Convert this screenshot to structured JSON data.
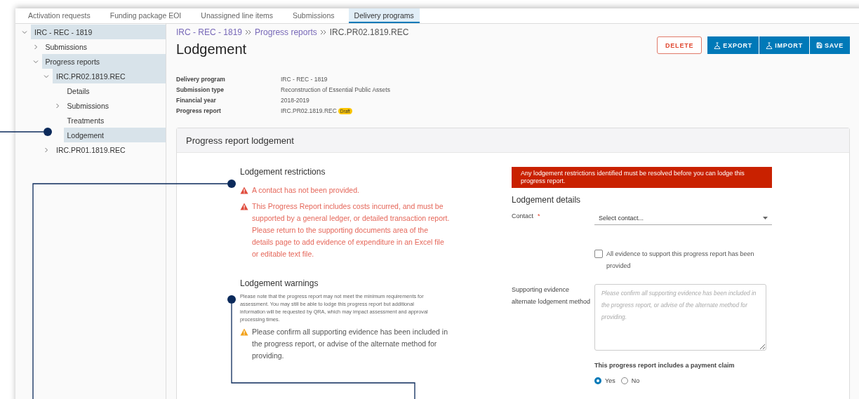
{
  "tabs": [
    {
      "label": "Activation requests",
      "selected": false
    },
    {
      "label": "Funding package EOI",
      "selected": false
    },
    {
      "label": "Unassigned line items",
      "selected": false
    },
    {
      "label": "Submissions",
      "selected": false
    },
    {
      "label": "Delivery programs",
      "selected": true
    }
  ],
  "sidebar": {
    "items": [
      {
        "label": "IRC - REC - 1819",
        "selected": true,
        "expanded": true,
        "children": [
          {
            "label": "Submissions",
            "selected": false,
            "expanded": false
          },
          {
            "label": "Progress reports",
            "selected": true,
            "expanded": true,
            "children": [
              {
                "label": "IRC.PR02.1819.REC",
                "selected": true,
                "expanded": true,
                "children": [
                  {
                    "label": "Details",
                    "selected": false
                  },
                  {
                    "label": "Submissions",
                    "selected": false,
                    "expanded": false
                  },
                  {
                    "label": "Treatments",
                    "selected": false
                  },
                  {
                    "label": "Lodgement",
                    "selected": true
                  }
                ]
              },
              {
                "label": "IRC.PR01.1819.REC",
                "selected": false,
                "expanded": false
              }
            ]
          }
        ]
      }
    ]
  },
  "breadcrumb": [
    {
      "label": "IRC - REC - 1819",
      "kind": "link"
    },
    {
      "label": "Progress reports",
      "kind": "link"
    },
    {
      "label": "IRC.PR02.1819.REC",
      "kind": "current"
    }
  ],
  "title": "Lodgement",
  "actions": [
    {
      "label": "DELETE",
      "kind": "danger"
    },
    {
      "label": "EXPORT",
      "kind": "export"
    },
    {
      "label": "IMPORT",
      "kind": "import"
    },
    {
      "label": "SAVE",
      "kind": "save"
    }
  ],
  "details": [
    {
      "label": "Delivery program",
      "value": "IRC - REC - 1819"
    },
    {
      "label": "Submission type",
      "value": "Reconstruction of Essential Public Assets"
    },
    {
      "label": "Financial year",
      "value": "2018-2019"
    },
    {
      "label": "Progress report",
      "value": "IRC.PR02.1819.REC",
      "badge": "Draft"
    }
  ],
  "card": {
    "title": "Progress report lodgement",
    "restrictions": {
      "heading": "Lodgement restrictions",
      "items": [
        "A contact has not been provided.",
        "This Progress Report includes costs incurred, and must be supported by a general ledger, or detailed transaction report. Please return to the supporting documents area of the details page to add evidence of expenditure in an Excel file or editable text file."
      ]
    },
    "warnings": {
      "heading": "Lodgement warnings",
      "note": "Please note that the progress report may not meet the minimum requirements for assessment. You may still be able to lodge this progress report but additional information will be requested by QRA, which may impact assessment and approval processing times.",
      "items": [
        "Please confirm all supporting evidence has been included in the progress report, or advise of the alternate method for providing."
      ]
    },
    "alert": "Any lodgement restrictions identified must be resolved before you can lodge this progress report.",
    "form": {
      "heading": "Lodgement details",
      "contact": {
        "label": "Contact",
        "required_mark": "*",
        "placeholder": "Select contact..."
      },
      "evidence_checkbox": {
        "label": "All evidence to support this progress report has been provided",
        "checked": false
      },
      "alternate_method": {
        "label": "Supporting evidence alternate lodgement method",
        "placeholder": "Please confirm all supporting evidence has been included in the progress report, or advise of the alternate method for providing."
      },
      "payment_claim": {
        "label": "This progress report includes a payment claim",
        "options": [
          {
            "label": "Yes",
            "selected": true
          },
          {
            "label": "No",
            "selected": false
          }
        ]
      }
    }
  }
}
